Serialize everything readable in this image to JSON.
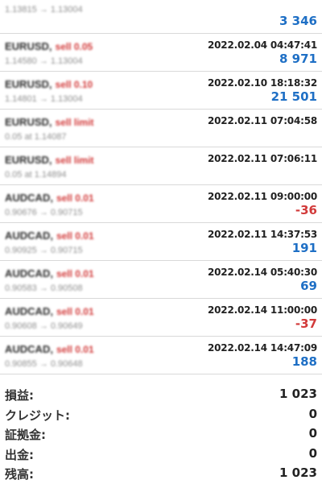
{
  "deals": [
    {
      "symbol": "■■■■■■",
      "side": "■■■■",
      "prices": "1.13815 → 1.13004",
      "time": "",
      "profit": "3 346",
      "sign": "pos"
    },
    {
      "symbol": "EURUSD,",
      "side": "sell 0.05",
      "prices": "1.14580 → 1.13004",
      "time": "2022.02.04 04:47:41",
      "profit": "8 971",
      "sign": "pos"
    },
    {
      "symbol": "EURUSD,",
      "side": "sell 0.10",
      "prices": "1.14801 → 1.13004",
      "time": "2022.02.10 18:18:32",
      "profit": "21 501",
      "sign": "pos"
    },
    {
      "symbol": "EURUSD,",
      "side": "sell limit",
      "prices": "0.05 at 1.14087",
      "time": "2022.02.11 07:04:58",
      "profit": "",
      "sign": "pos"
    },
    {
      "symbol": "EURUSD,",
      "side": "sell limit",
      "prices": "0.05 at 1.14894",
      "time": "2022.02.11 07:06:11",
      "profit": "",
      "sign": "pos"
    },
    {
      "symbol": "AUDCAD,",
      "side": "sell 0.01",
      "prices": "0.90676 → 0.90715",
      "time": "2022.02.11 09:00:00",
      "profit": "-36",
      "sign": "neg"
    },
    {
      "symbol": "AUDCAD,",
      "side": "sell 0.01",
      "prices": "0.90925 → 0.90715",
      "time": "2022.02.11 14:37:53",
      "profit": "191",
      "sign": "pos"
    },
    {
      "symbol": "AUDCAD,",
      "side": "sell 0.01",
      "prices": "0.90583 → 0.90508",
      "time": "2022.02.14 05:40:30",
      "profit": "69",
      "sign": "pos"
    },
    {
      "symbol": "AUDCAD,",
      "side": "sell 0.01",
      "prices": "0.90608 → 0.90649",
      "time": "2022.02.14 11:00:00",
      "profit": "-37",
      "sign": "neg"
    },
    {
      "symbol": "AUDCAD,",
      "side": "sell 0.01",
      "prices": "0.90855 → 0.90648",
      "time": "2022.02.14 14:47:09",
      "profit": "188",
      "sign": "pos"
    }
  ],
  "summary": {
    "profit_label": "損益:",
    "profit_value": "1 023",
    "credit_label": "クレジット:",
    "credit_value": "0",
    "deposit_label": "証拠金:",
    "deposit_value": "0",
    "withdrawal_label": "出金:",
    "withdrawal_value": "0",
    "balance_label": "残高:",
    "balance_value": "1 023"
  },
  "colors": {
    "positive": "#1e6fc5",
    "negative": "#d23a3a"
  }
}
